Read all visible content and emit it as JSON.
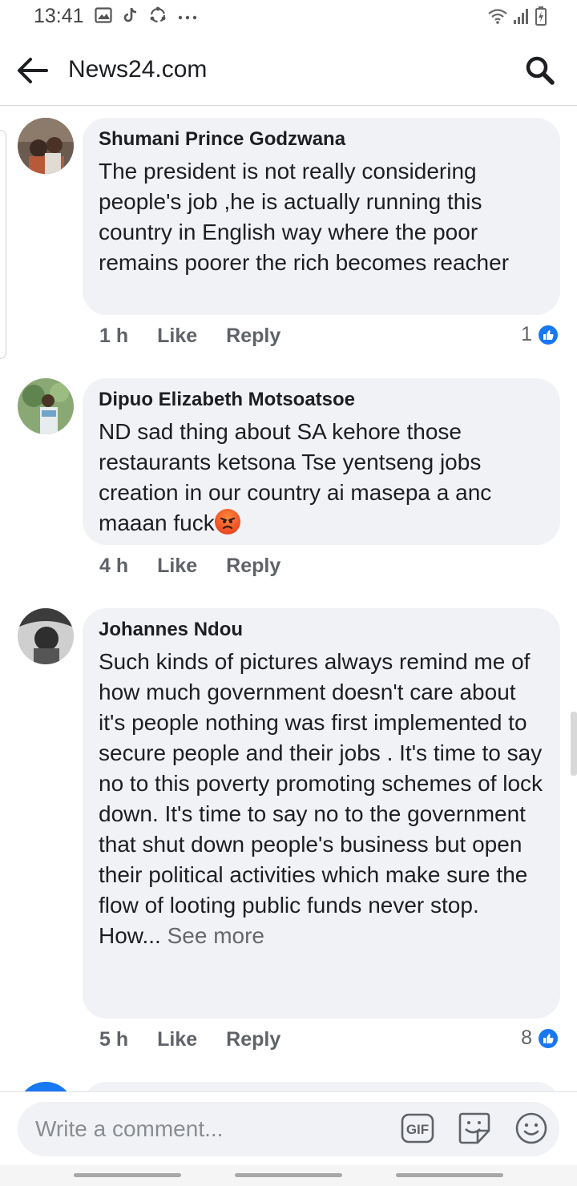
{
  "status_bar": {
    "time": "13:41",
    "icons": [
      "gallery-icon",
      "tiktok-icon",
      "sync-icon",
      "more-dots-icon"
    ],
    "right_icons": [
      "wifi-icon",
      "signal-icon",
      "battery-icon"
    ]
  },
  "header": {
    "title": "News24.com",
    "back_icon": "arrow-left-icon",
    "search_icon": "search-icon"
  },
  "comments": [
    {
      "author": "Shumani Prince Godzwana",
      "text": "The president is not really considering people's job ,he is actually running this country in English way where the poor remains poorer the rich becomes reacher",
      "time": "1 h",
      "like_label": "Like",
      "reply_label": "Reply",
      "reaction_count": "1"
    },
    {
      "author": "Dipuo Elizabeth Motsoatsoe",
      "text": "ND sad thing about SA kehore those restaurants ketsona Tse yentseng jobs creation in our country ai masepa a anc maaan fuck",
      "emoji": "angry-face-emoji",
      "time": "4 h",
      "like_label": "Like",
      "reply_label": "Reply"
    },
    {
      "author": "Johannes Ndou",
      "text": "Such kinds of pictures always remind me of how much government doesn't care about it's people nothing was first implemented to secure people and their jobs . It's time to say no to this poverty promoting schemes of lock down. It's time to say no to the government that shut down  people's business but open their political activities which make sure the flow of looting public funds never stop.",
      "text_tail": "How...",
      "see_more": "See more",
      "time": "5 h",
      "like_label": "Like",
      "reply_label": "Reply",
      "reaction_count": "8"
    }
  ],
  "composer": {
    "placeholder": "Write a comment...",
    "icons": [
      "gif-icon",
      "sticker-icon",
      "emoji-icon"
    ]
  },
  "colors": {
    "bubble": "#f0f2f5",
    "like_blue": "#1877f2",
    "meta_text": "#5f6368"
  }
}
